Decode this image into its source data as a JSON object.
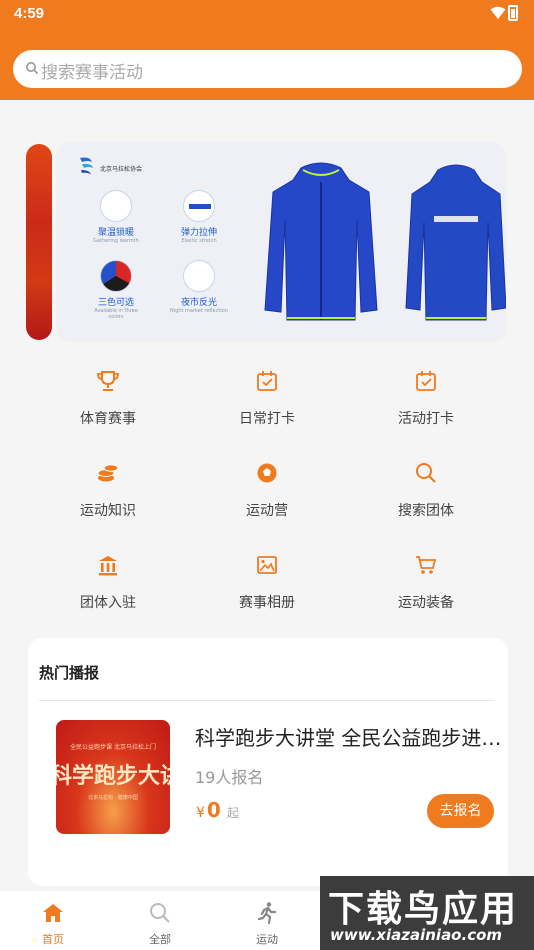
{
  "status_bar": {
    "time": "4:59"
  },
  "search": {
    "placeholder": "搜索赛事活动"
  },
  "banner": {
    "features": [
      {
        "label": "聚温锁暖",
        "sub": "Gathering warmth"
      },
      {
        "label": "弹力拉伸",
        "sub": "Elastic stretch"
      },
      {
        "label": "三色可选",
        "sub": "Available in three colors"
      },
      {
        "label": "夜市反光",
        "sub": "Night market reflection"
      }
    ],
    "logo_text": "北京马拉松协会"
  },
  "grid": {
    "items": [
      {
        "label": "体育赛事",
        "icon": "trophy-icon"
      },
      {
        "label": "日常打卡",
        "icon": "calendar-check-icon"
      },
      {
        "label": "活动打卡",
        "icon": "calendar-check-icon"
      },
      {
        "label": "运动知识",
        "icon": "coins-stack-icon"
      },
      {
        "label": "运动营",
        "icon": "ball-icon"
      },
      {
        "label": "搜索团体",
        "icon": "search-icon"
      },
      {
        "label": "团体入驻",
        "icon": "building-icon"
      },
      {
        "label": "赛事相册",
        "icon": "image-icon"
      },
      {
        "label": "运动装备",
        "icon": "cart-icon"
      }
    ]
  },
  "hot": {
    "title": "热门播报",
    "event": {
      "title": "科学跑步大讲堂 全民公益跑步进校园",
      "count": "19人报名",
      "price_symbol": "¥",
      "price": "0",
      "price_suffix": "起",
      "button": "去报名",
      "image_top": "全民公益跑步课 北京马拉松上门",
      "image_big": "科学跑步大讲堂",
      "image_bottom": "北京马拉松 · 健康中国"
    }
  },
  "tabbar": {
    "tabs": [
      {
        "label": "首页",
        "icon": "home-icon"
      },
      {
        "label": "全部",
        "icon": "search-icon"
      },
      {
        "label": "运动",
        "icon": "runner-icon"
      }
    ]
  },
  "watermark": {
    "text": "下载鸟应用",
    "url": "www.xiazainiao.com"
  },
  "colors": {
    "accent": "#f07a1e"
  }
}
